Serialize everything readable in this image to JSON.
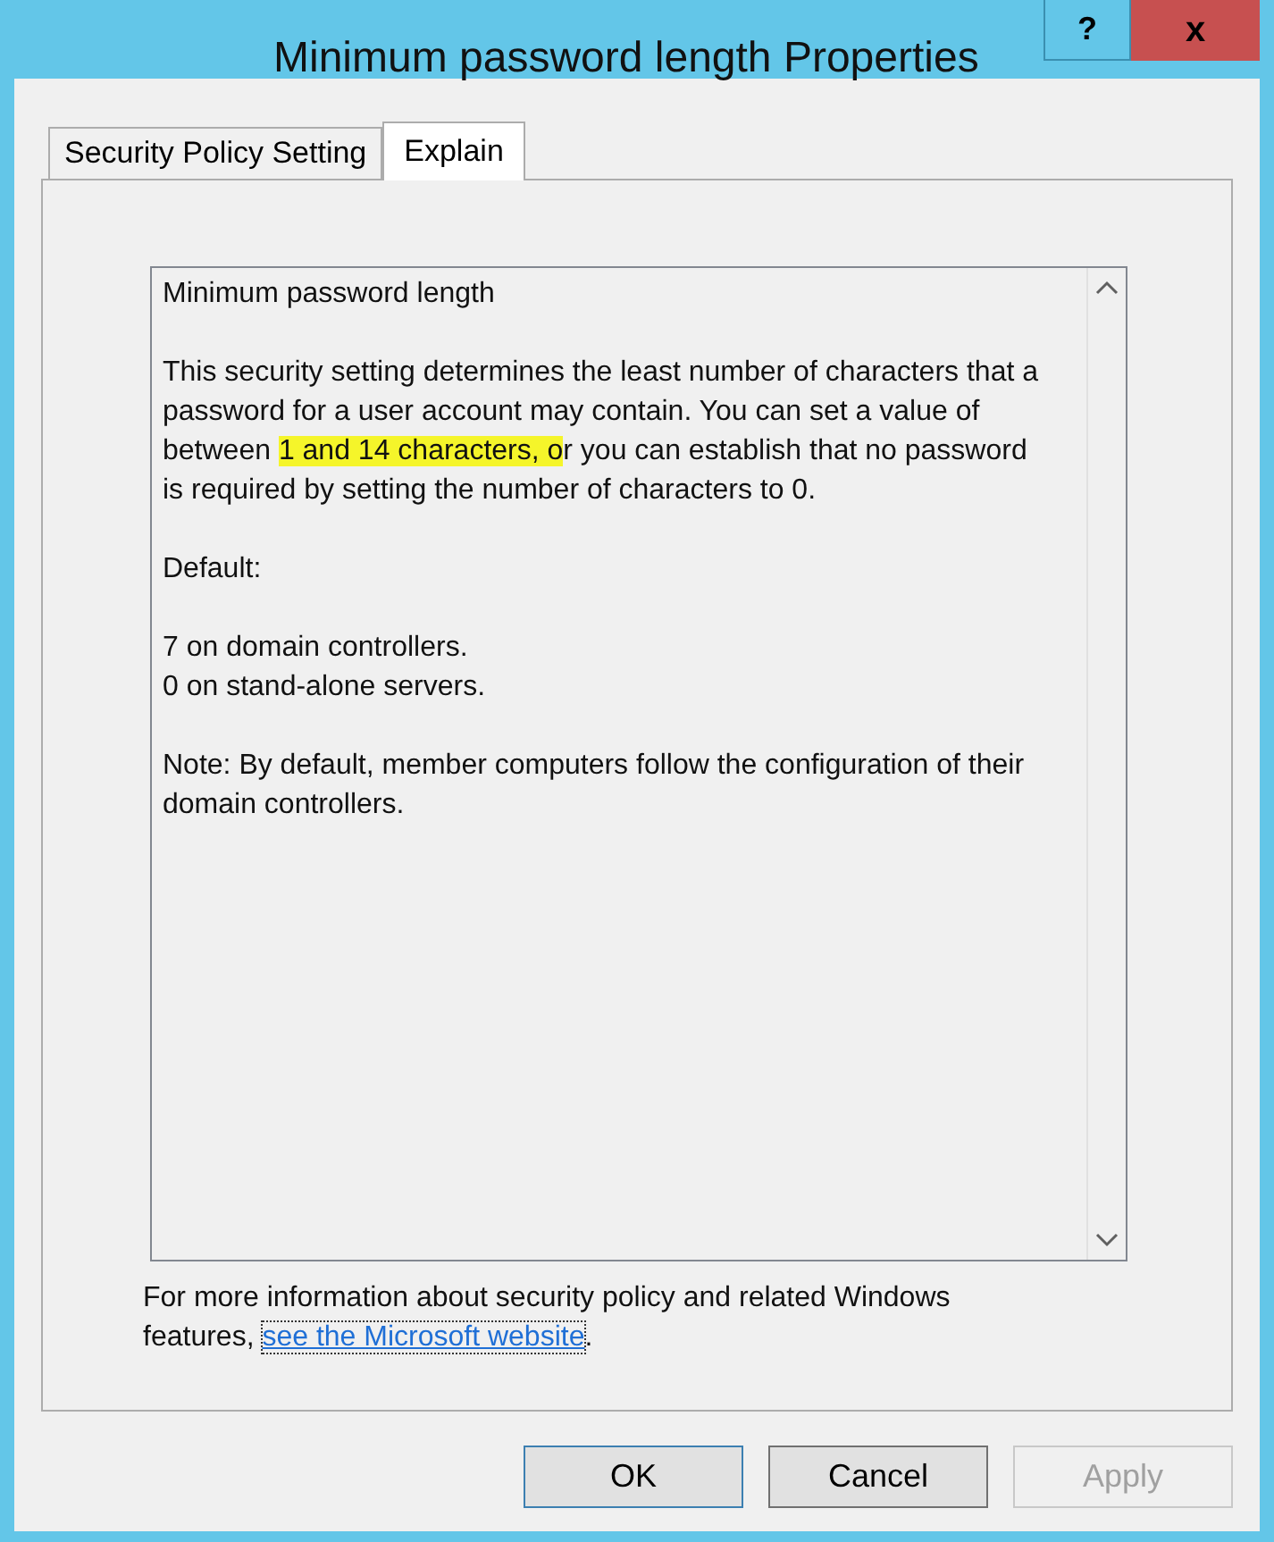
{
  "window": {
    "title": "Minimum password length Properties",
    "help_button": "?",
    "close_button": "x"
  },
  "tabs": [
    {
      "label": "Security Policy Setting",
      "selected": false
    },
    {
      "label": "Explain",
      "selected": true
    }
  ],
  "explain": {
    "paragraphs": [
      {
        "segments": [
          {
            "text": "Minimum password length",
            "highlighted": false
          }
        ]
      },
      {
        "segments": [
          {
            "text": "This security setting determines the least number of characters that a password for a user account may contain. You can set a value of between ",
            "highlighted": false
          },
          {
            "text": "1 and 14 characters, o",
            "highlighted": true
          },
          {
            "text": "r you can establish that no password is required by setting the number of characters to 0.",
            "highlighted": false
          }
        ]
      },
      {
        "segments": [
          {
            "text": "Default:",
            "highlighted": false
          }
        ]
      },
      {
        "lines": [
          "7 on domain controllers.",
          "0 on stand-alone servers."
        ]
      },
      {
        "segments": [
          {
            "text": "Note: By default, member computers follow the configuration of their domain controllers.",
            "highlighted": false
          }
        ]
      }
    ]
  },
  "footer": {
    "text": "For more information about security policy and related Windows features, ",
    "link": "see the Microsoft website",
    "after": "."
  },
  "buttons": [
    {
      "label": "OK",
      "default": true,
      "disabled": false
    },
    {
      "label": "Cancel",
      "default": false,
      "disabled": false
    },
    {
      "label": "Apply",
      "default": false,
      "disabled": true
    }
  ]
}
